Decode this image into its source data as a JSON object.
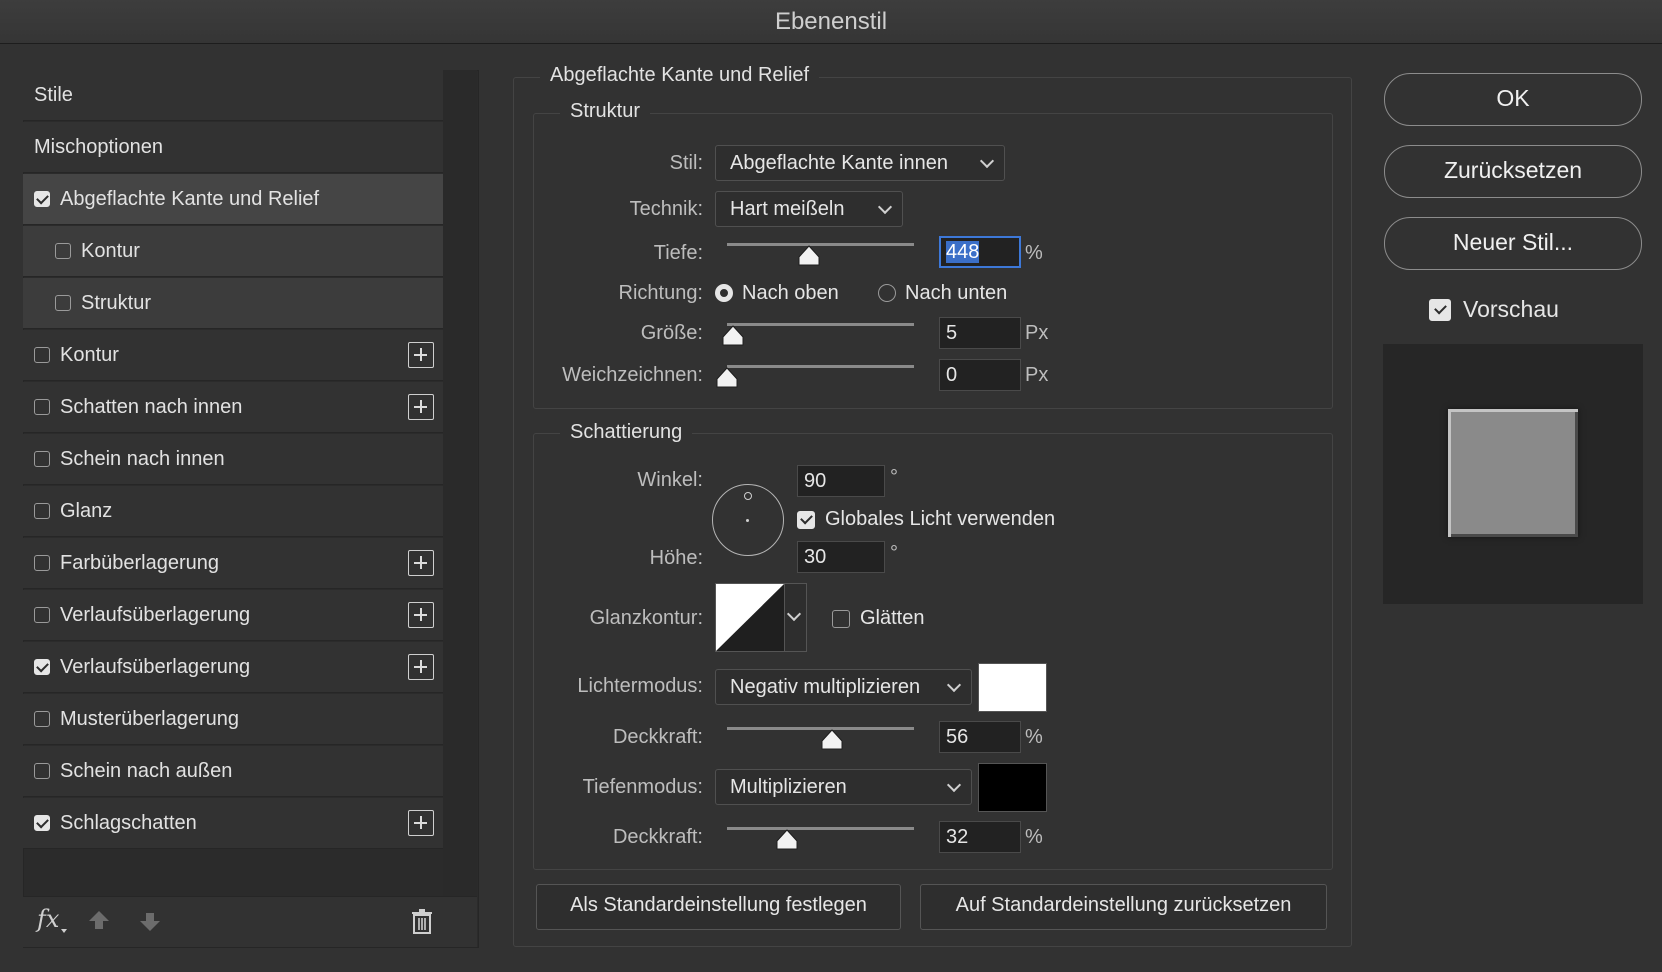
{
  "window": {
    "title": "Ebenenstil"
  },
  "styles_list": [
    {
      "label": "Stile",
      "checkbox": null,
      "plus": false,
      "kind": "header"
    },
    {
      "label": "Mischoptionen",
      "checkbox": null,
      "plus": false,
      "kind": "header"
    },
    {
      "label": "Abgeflachte Kante und Relief",
      "checkbox": true,
      "plus": false,
      "kind": "selected"
    },
    {
      "label": "Kontur",
      "checkbox": false,
      "plus": false,
      "kind": "sub"
    },
    {
      "label": "Struktur",
      "checkbox": false,
      "plus": false,
      "kind": "sub"
    },
    {
      "label": "Kontur",
      "checkbox": false,
      "plus": true,
      "kind": "item"
    },
    {
      "label": "Schatten nach innen",
      "checkbox": false,
      "plus": true,
      "kind": "item"
    },
    {
      "label": "Schein nach innen",
      "checkbox": false,
      "plus": false,
      "kind": "item"
    },
    {
      "label": "Glanz",
      "checkbox": false,
      "plus": false,
      "kind": "item"
    },
    {
      "label": "Farbüberlagerung",
      "checkbox": false,
      "plus": true,
      "kind": "item"
    },
    {
      "label": "Verlaufsüberlagerung",
      "checkbox": false,
      "plus": true,
      "kind": "item"
    },
    {
      "label": "Verlaufsüberlagerung",
      "checkbox": true,
      "plus": true,
      "kind": "item"
    },
    {
      "label": "Musterüberlagerung",
      "checkbox": false,
      "plus": false,
      "kind": "item"
    },
    {
      "label": "Schein nach außen",
      "checkbox": false,
      "plus": false,
      "kind": "item"
    },
    {
      "label": "Schlagschatten",
      "checkbox": true,
      "plus": true,
      "kind": "item"
    }
  ],
  "bottom_toolbar": {
    "fx_label": "fx",
    "icons": [
      "fx-icon",
      "arrow-up-icon",
      "arrow-down-icon",
      "trash-icon"
    ]
  },
  "panel": {
    "title": "Abgeflachte Kante und Relief",
    "struktur": {
      "legend": "Struktur",
      "stil_label": "Stil:",
      "stil_value": "Abgeflachte Kante innen",
      "technik_label": "Technik:",
      "technik_value": "Hart meißeln",
      "tiefe_label": "Tiefe:",
      "tiefe_value": "448",
      "tiefe_unit": "%",
      "tiefe_slider": 0.44,
      "richtung_label": "Richtung:",
      "richtung_up": "Nach oben",
      "richtung_down": "Nach unten",
      "richtung_selected": "up",
      "groesse_label": "Größe:",
      "groesse_value": "5",
      "groesse_unit": "Px",
      "groesse_slider": 0.03,
      "weich_label": "Weichzeichnen:",
      "weich_value": "0",
      "weich_unit": "Px",
      "weich_slider": 0.0
    },
    "schattierung": {
      "legend": "Schattierung",
      "winkel_label": "Winkel:",
      "winkel_value": "90",
      "winkel_unit": "°",
      "global_light_label": "Globales Licht verwenden",
      "global_light": true,
      "hoehe_label": "Höhe:",
      "hoehe_value": "30",
      "hoehe_unit": "°",
      "glanzkontur_label": "Glanzkontur:",
      "glaetten_label": "Glätten",
      "glaetten": false,
      "lichtermodus_label": "Lichtermodus:",
      "lichtermodus_value": "Negativ multiplizieren",
      "lichter_color": "#ffffff",
      "deckkraft1_label": "Deckkraft:",
      "deckkraft1_value": "56",
      "deckkraft1_unit": "%",
      "deckkraft1_slider": 0.56,
      "tiefenmodus_label": "Tiefenmodus:",
      "tiefenmodus_value": "Multiplizieren",
      "tiefen_color": "#000000",
      "deckkraft2_label": "Deckkraft:",
      "deckkraft2_value": "32",
      "deckkraft2_unit": "%",
      "deckkraft2_slider": 0.32
    },
    "default_set": "Als Standardeinstellung festlegen",
    "default_reset": "Auf Standardeinstellung zurücksetzen"
  },
  "right": {
    "ok": "OK",
    "reset": "Zurücksetzen",
    "new_style": "Neuer Stil...",
    "preview_label": "Vorschau",
    "preview_checked": true
  }
}
